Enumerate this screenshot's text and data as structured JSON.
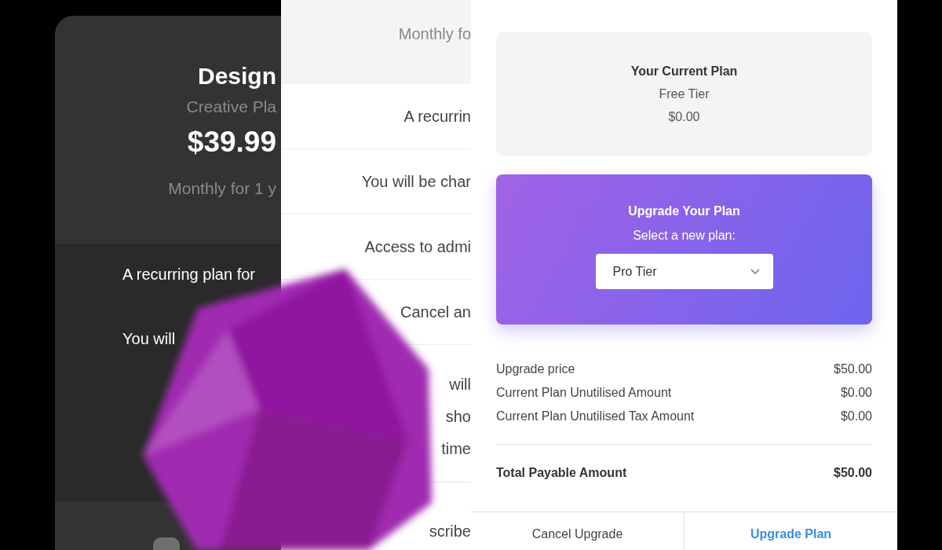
{
  "plan_cards": [
    {
      "title": "Design",
      "subtitle": "Creative Pla",
      "price": "$39.99",
      "billing": "Monthly for 1 y",
      "features": [
        "A recurring plan for",
        "You will"
      ]
    },
    {
      "billing": "Monthly fo",
      "features": [
        "A recurrin",
        "You will be char",
        "Access to admi",
        "Cancel an"
      ],
      "note_lines": [
        "will",
        "sho",
        "time"
      ],
      "footer_button": "scribe"
    }
  ],
  "upgrade_dialog": {
    "current_plan": {
      "heading": "Your Current Plan",
      "name": "Free Tier",
      "price": "$0.00"
    },
    "upgrade_panel": {
      "heading": "Upgrade Your Plan",
      "prompt": "Select a new plan:",
      "plan_select": "Pro Tier"
    },
    "line_items": [
      {
        "label": "Upgrade price",
        "amount": "$50.00"
      },
      {
        "label": "Current Plan Unutilised Amount",
        "amount": "$0.00"
      },
      {
        "label": "Current Plan Unutilised Tax Amount",
        "amount": "$0.00"
      }
    ],
    "total": {
      "label": "Total Payable Amount",
      "amount": "$50.00"
    },
    "buttons": [
      {
        "label": "Cancel Upgrade",
        "kind": "secondary"
      },
      {
        "label": "Upgrade Plan",
        "kind": "primary"
      }
    ]
  }
}
